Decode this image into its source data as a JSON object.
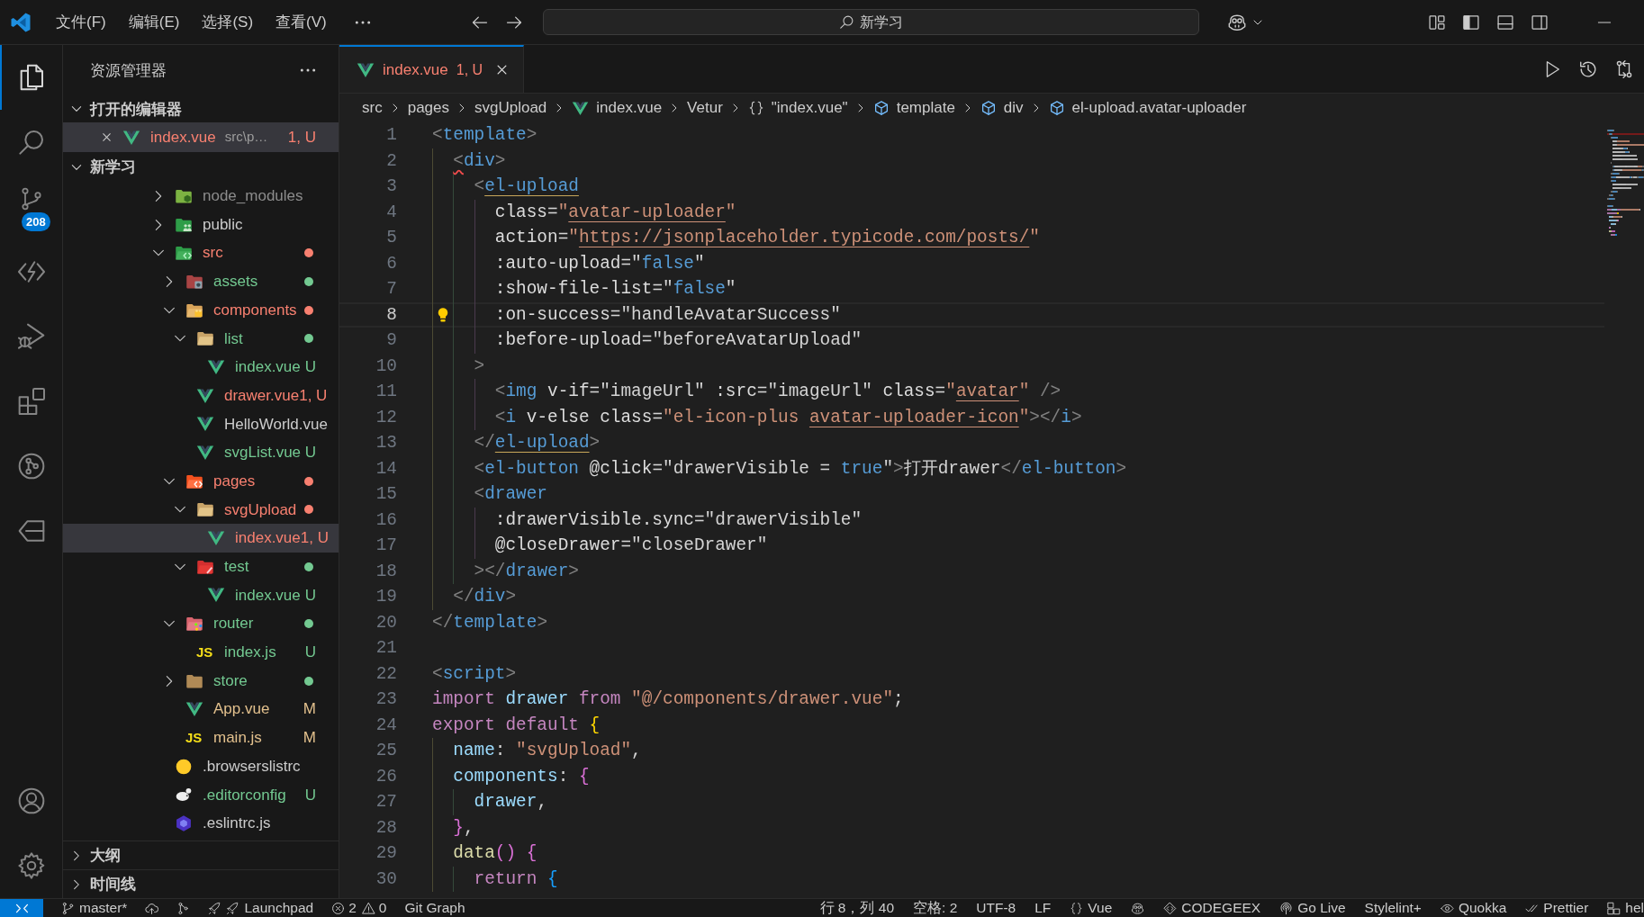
{
  "title_bar": {
    "menus": [
      "文件(F)",
      "编辑(E)",
      "选择(S)",
      "查看(V)"
    ],
    "command_center": {
      "label": "新学习"
    }
  },
  "activity_bar": {
    "items": [
      {
        "kind": "explorer",
        "selected": true
      },
      {
        "kind": "search",
        "selected": false
      },
      {
        "kind": "scm",
        "selected": false,
        "badge": "208"
      },
      {
        "kind": "brackets",
        "selected": false
      },
      {
        "kind": "debug",
        "selected": false
      },
      {
        "kind": "extensions",
        "selected": false
      },
      {
        "kind": "gitgraph",
        "selected": false
      },
      {
        "kind": "tagarrow",
        "selected": false
      }
    ],
    "bottom": [
      {
        "kind": "account"
      },
      {
        "kind": "settings"
      }
    ]
  },
  "sidebar": {
    "title": "资源管理器",
    "open_editors": {
      "title": "打开的编辑器",
      "expanded": true,
      "items": [
        {
          "kind": "vue",
          "name": "index.vue",
          "path": "src\\p…",
          "badge": "1, U",
          "color": "#f88070",
          "selected": true
        }
      ]
    },
    "workspace": {
      "title": "新学习",
      "expanded": true,
      "tree": [
        {
          "kind": "node",
          "name": "node_modules",
          "expanded": false,
          "selected": false,
          "color": "#8c8c8c",
          "has_changes": false
        },
        {
          "kind": "public",
          "name": "public",
          "expanded": false,
          "selected": false,
          "color": "#cccccc",
          "has_changes": false
        },
        {
          "kind": "src",
          "name": "src",
          "expanded": true,
          "selected": false,
          "color": "#f88070",
          "has_changes": true,
          "children": [
            {
              "kind": "assets",
              "name": "assets",
              "expanded": false,
              "selected": false,
              "color": "#73c991",
              "has_changes": true
            },
            {
              "kind": "components",
              "name": "components",
              "expanded": true,
              "selected": false,
              "color": "#f88070",
              "has_changes": true,
              "children": [
                {
                  "kind": "folder",
                  "name": "list",
                  "expanded": true,
                  "selected": false,
                  "color": "#73c991",
                  "has_changes": true,
                  "children": [
                    {
                      "kind": "vue",
                      "name": "index.vue",
                      "selected": false,
                      "color": "#73c991",
                      "badge": "U"
                    }
                  ]
                },
                {
                  "kind": "vue",
                  "name": "drawer.vue",
                  "selected": false,
                  "color": "#f88070",
                  "badge": "1, U"
                },
                {
                  "kind": "vue",
                  "name": "HelloWorld.vue",
                  "selected": false,
                  "color": "#cccccc"
                },
                {
                  "kind": "vue",
                  "name": "svgList.vue",
                  "selected": false,
                  "color": "#73c991",
                  "badge": "U"
                }
              ]
            },
            {
              "kind": "pages",
              "name": "pages",
              "expanded": true,
              "selected": false,
              "color": "#f88070",
              "has_changes": true,
              "children": [
                {
                  "kind": "folder",
                  "name": "svgUpload",
                  "expanded": true,
                  "selected": false,
                  "color": "#f88070",
                  "has_changes": true,
                  "children": [
                    {
                      "kind": "vue",
                      "name": "index.vue",
                      "selected": true,
                      "color": "#f88070",
                      "badge": "1, U"
                    }
                  ]
                },
                {
                  "kind": "test",
                  "name": "test",
                  "expanded": true,
                  "selected": false,
                  "color": "#73c991",
                  "has_changes": true,
                  "children": [
                    {
                      "kind": "vue",
                      "name": "index.vue",
                      "selected": false,
                      "color": "#73c991",
                      "badge": "U"
                    }
                  ]
                }
              ]
            },
            {
              "kind": "router",
              "name": "router",
              "expanded": true,
              "selected": false,
              "color": "#73c991",
              "has_changes": true,
              "children": [
                {
                  "kind": "js",
                  "icon_text": "JS",
                  "name": "index.js",
                  "selected": false,
                  "color": "#73c991",
                  "badge": "U"
                }
              ]
            },
            {
              "kind": "store",
              "name": "store",
              "expanded": false,
              "selected": false,
              "color": "#73c991",
              "has_changes": true
            },
            {
              "kind": "vue",
              "name": "App.vue",
              "selected": false,
              "color": "#e2c08d",
              "badge": "M"
            },
            {
              "kind": "js",
              "icon_text": "JS",
              "name": "main.js",
              "selected": false,
              "color": "#e2c08d",
              "badge": "M"
            }
          ]
        },
        {
          "kind": "browserslist",
          "name": ".browserslistrc",
          "selected": false,
          "color": "#cccccc"
        },
        {
          "kind": "editorconfig",
          "name": ".editorconfig",
          "selected": false,
          "color": "#73c991",
          "badge": "U"
        },
        {
          "kind": "eslint",
          "name": ".eslintrc.js",
          "selected": false,
          "color": "#cccccc"
        }
      ]
    },
    "outline": {
      "title": "大纲",
      "expanded": false
    },
    "timeline": {
      "title": "时间线",
      "expanded": false
    }
  },
  "editor": {
    "tabs": [
      {
        "kind": "vue",
        "label": "index.vue",
        "badge": "1, U",
        "color": "#f88070",
        "selected": true
      }
    ],
    "breadcrumb": [
      {
        "kind": "plain",
        "label": "src"
      },
      {
        "kind": "plain",
        "label": "pages"
      },
      {
        "kind": "plain",
        "label": "svgUpload"
      },
      {
        "kind": "vue",
        "label": "index.vue"
      },
      {
        "kind": "plain",
        "label": "Vetur"
      },
      {
        "kind": "braces",
        "label": "\"index.vue\""
      },
      {
        "kind": "element",
        "label": "template"
      },
      {
        "kind": "element",
        "label": "div"
      },
      {
        "kind": "element",
        "label": "el-upload.avatar-uploader"
      }
    ],
    "lines": [
      {
        "number": "1",
        "current": false,
        "lightbulb": false,
        "tokens": [
          {
            "kind": "punct",
            "text": "<"
          },
          {
            "kind": "tag",
            "text": "template"
          },
          {
            "kind": "punct",
            "text": ">"
          }
        ]
      },
      {
        "number": "2",
        "current": false,
        "lightbulb": false,
        "tokens": [
          {
            "kind": "errpunct",
            "text": "  <"
          },
          {
            "kind": "tag",
            "text": "div"
          },
          {
            "kind": "punct",
            "text": ">"
          }
        ]
      },
      {
        "number": "3",
        "current": false,
        "lightbulb": false,
        "tokens": [
          {
            "kind": "punct",
            "text": "    <"
          },
          {
            "kind": "tagref",
            "text": "el-upload"
          }
        ]
      },
      {
        "number": "4",
        "current": false,
        "lightbulb": false,
        "tokens": [
          {
            "kind": "attr",
            "text": "      class"
          },
          {
            "kind": "text",
            "text": "="
          },
          {
            "kind": "str",
            "text": "\""
          },
          {
            "kind": "link",
            "text": "avatar-uploader"
          },
          {
            "kind": "str",
            "text": "\""
          }
        ]
      },
      {
        "number": "5",
        "current": false,
        "lightbulb": false,
        "tokens": [
          {
            "kind": "attr",
            "text": "      action"
          },
          {
            "kind": "text",
            "text": "="
          },
          {
            "kind": "str",
            "text": "\""
          },
          {
            "kind": "link",
            "text": "https://jsonplaceholder.typicode.com/posts/"
          },
          {
            "kind": "str",
            "text": "\""
          }
        ]
      },
      {
        "number": "6",
        "current": false,
        "lightbulb": false,
        "tokens": [
          {
            "kind": "attr",
            "text": "      :auto-upload"
          },
          {
            "kind": "text",
            "text": "=\""
          },
          {
            "kind": "kw",
            "text": "false"
          },
          {
            "kind": "text",
            "text": "\""
          }
        ]
      },
      {
        "number": "7",
        "current": false,
        "lightbulb": false,
        "tokens": [
          {
            "kind": "attr",
            "text": "      :show-file-list"
          },
          {
            "kind": "text",
            "text": "=\""
          },
          {
            "kind": "kw",
            "text": "false"
          },
          {
            "kind": "text",
            "text": "\""
          }
        ]
      },
      {
        "number": "8",
        "current": true,
        "lightbulb": true,
        "tokens": [
          {
            "kind": "attr",
            "text": "      :on-success"
          },
          {
            "kind": "text",
            "text": "=\"handleAvatarSuccess\""
          }
        ]
      },
      {
        "number": "9",
        "current": false,
        "lightbulb": false,
        "tokens": [
          {
            "kind": "attr",
            "text": "      :before-upload"
          },
          {
            "kind": "text",
            "text": "=\"beforeAvatarUpload\""
          }
        ]
      },
      {
        "number": "10",
        "current": false,
        "lightbulb": false,
        "tokens": [
          {
            "kind": "punct",
            "text": "    >"
          }
        ]
      },
      {
        "number": "11",
        "current": false,
        "lightbulb": false,
        "tokens": [
          {
            "kind": "punct",
            "text": "      <"
          },
          {
            "kind": "tag",
            "text": "img"
          },
          {
            "kind": "attr",
            "text": " v-if"
          },
          {
            "kind": "text",
            "text": "=\"imageUrl\" "
          },
          {
            "kind": "attr",
            "text": ":src"
          },
          {
            "kind": "text",
            "text": "=\"imageUrl\" "
          },
          {
            "kind": "attr",
            "text": "class"
          },
          {
            "kind": "text",
            "text": "="
          },
          {
            "kind": "str",
            "text": "\""
          },
          {
            "kind": "link",
            "text": "avatar"
          },
          {
            "kind": "str",
            "text": "\""
          },
          {
            "kind": "punct",
            "text": " />"
          }
        ]
      },
      {
        "number": "12",
        "current": false,
        "lightbulb": false,
        "tokens": [
          {
            "kind": "punct",
            "text": "      <"
          },
          {
            "kind": "tag",
            "text": "i"
          },
          {
            "kind": "attr",
            "text": " v-else"
          },
          {
            "kind": "attr",
            "text": " class"
          },
          {
            "kind": "text",
            "text": "="
          },
          {
            "kind": "str",
            "text": "\"el-icon-plus "
          },
          {
            "kind": "link",
            "text": "avatar-uploader-icon"
          },
          {
            "kind": "str",
            "text": "\""
          },
          {
            "kind": "punct",
            "text": "></"
          },
          {
            "kind": "tag",
            "text": "i"
          },
          {
            "kind": "punct",
            "text": ">"
          }
        ]
      },
      {
        "number": "13",
        "current": false,
        "lightbulb": false,
        "tokens": [
          {
            "kind": "punct",
            "text": "    </"
          },
          {
            "kind": "tagref",
            "text": "el-upload"
          },
          {
            "kind": "punct",
            "text": ">"
          }
        ]
      },
      {
        "number": "14",
        "current": false,
        "lightbulb": false,
        "tokens": [
          {
            "kind": "punct",
            "text": "    <"
          },
          {
            "kind": "tag",
            "text": "el-button"
          },
          {
            "kind": "attr",
            "text": " @click"
          },
          {
            "kind": "text",
            "text": "=\"drawerVisible = "
          },
          {
            "kind": "kw",
            "text": "true"
          },
          {
            "kind": "text",
            "text": "\""
          },
          {
            "kind": "punct",
            "text": ">"
          },
          {
            "kind": "text",
            "text": "打开drawer"
          },
          {
            "kind": "punct",
            "text": "</"
          },
          {
            "kind": "tag",
            "text": "el-button"
          },
          {
            "kind": "punct",
            "text": ">"
          }
        ]
      },
      {
        "number": "15",
        "current": false,
        "lightbulb": false,
        "tokens": [
          {
            "kind": "punct",
            "text": "    <"
          },
          {
            "kind": "tag",
            "text": "drawer"
          }
        ]
      },
      {
        "number": "16",
        "current": false,
        "lightbulb": false,
        "tokens": [
          {
            "kind": "attr",
            "text": "      :drawerVisible.sync"
          },
          {
            "kind": "text",
            "text": "=\"drawerVisible\""
          }
        ]
      },
      {
        "number": "17",
        "current": false,
        "lightbulb": false,
        "tokens": [
          {
            "kind": "attr",
            "text": "      @closeDrawer"
          },
          {
            "kind": "text",
            "text": "=\"closeDrawer\""
          }
        ]
      },
      {
        "number": "18",
        "current": false,
        "lightbulb": false,
        "tokens": [
          {
            "kind": "punct",
            "text": "    ></"
          },
          {
            "kind": "tag",
            "text": "drawer"
          },
          {
            "kind": "punct",
            "text": ">"
          }
        ]
      },
      {
        "number": "19",
        "current": false,
        "lightbulb": false,
        "tokens": [
          {
            "kind": "punct",
            "text": "  </"
          },
          {
            "kind": "tag",
            "text": "div"
          },
          {
            "kind": "punct",
            "text": ">"
          }
        ]
      },
      {
        "number": "20",
        "current": false,
        "lightbulb": false,
        "tokens": [
          {
            "kind": "punct",
            "text": "</"
          },
          {
            "kind": "tag",
            "text": "template"
          },
          {
            "kind": "punct",
            "text": ">"
          }
        ]
      },
      {
        "number": "21",
        "current": false,
        "lightbulb": false
      },
      {
        "number": "22",
        "current": false,
        "lightbulb": false,
        "tokens": [
          {
            "kind": "punct",
            "text": "<"
          },
          {
            "kind": "tag",
            "text": "script"
          },
          {
            "kind": "punct",
            "text": ">"
          }
        ]
      },
      {
        "number": "23",
        "current": false,
        "lightbulb": false,
        "tokens": [
          {
            "kind": "ctrl",
            "text": "import"
          },
          {
            "kind": "var",
            "text": " drawer"
          },
          {
            "kind": "ctrl",
            "text": " from"
          },
          {
            "kind": "str",
            "text": " \"@/components/drawer.vue\""
          },
          {
            "kind": "text",
            "text": ";"
          }
        ]
      },
      {
        "number": "24",
        "current": false,
        "lightbulb": false,
        "tokens": [
          {
            "kind": "ctrl",
            "text": "export"
          },
          {
            "kind": "ctrl",
            "text": " default"
          },
          {
            "kind": "brace1",
            "text": " {"
          }
        ]
      },
      {
        "number": "25",
        "current": false,
        "lightbulb": false,
        "tokens": [
          {
            "kind": "var",
            "text": "  name"
          },
          {
            "kind": "text",
            "text": ": "
          },
          {
            "kind": "str",
            "text": "\"svgUpload\""
          },
          {
            "kind": "text",
            "text": ","
          }
        ]
      },
      {
        "number": "26",
        "current": false,
        "lightbulb": false,
        "tokens": [
          {
            "kind": "var",
            "text": "  components"
          },
          {
            "kind": "text",
            "text": ": "
          },
          {
            "kind": "brace2",
            "text": "{"
          }
        ]
      },
      {
        "number": "27",
        "current": false,
        "lightbulb": false,
        "tokens": [
          {
            "kind": "var",
            "text": "    drawer"
          },
          {
            "kind": "text",
            "text": ","
          }
        ]
      },
      {
        "number": "28",
        "current": false,
        "lightbulb": false,
        "tokens": [
          {
            "kind": "brace2",
            "text": "  }"
          },
          {
            "kind": "text",
            "text": ","
          }
        ]
      },
      {
        "number": "29",
        "current": false,
        "lightbulb": false,
        "tokens": [
          {
            "kind": "fn",
            "text": "  data"
          },
          {
            "kind": "brace2",
            "text": "()"
          },
          {
            "kind": "brace2",
            "text": " {"
          }
        ]
      },
      {
        "number": "30",
        "current": false,
        "lightbulb": false,
        "tokens": [
          {
            "kind": "ctrl",
            "text": "    return"
          },
          {
            "kind": "brace3",
            "text": " {"
          }
        ]
      }
    ]
  },
  "status_bar": {
    "left": [
      {
        "kind": "remote"
      },
      {
        "kind": "branch",
        "label": "master*"
      },
      {
        "kind": "sync"
      },
      {
        "kind": "graph"
      },
      {
        "kind": "launchpad",
        "label": "Launchpad"
      },
      {
        "kind": "problems",
        "errors": "2",
        "warnings": "0"
      },
      {
        "kind": "plain",
        "label": "Git Graph"
      }
    ],
    "right": [
      {
        "kind": "plain",
        "label": "行 8，列 40"
      },
      {
        "kind": "plain",
        "label": "空格: 2"
      },
      {
        "kind": "plain",
        "label": "UTF-8"
      },
      {
        "kind": "plain",
        "label": "LF"
      },
      {
        "kind": "braces",
        "label": "Vue"
      },
      {
        "kind": "robot"
      },
      {
        "kind": "codegeex",
        "label": "CODEGEEX"
      },
      {
        "kind": "golive",
        "label": "Go Live"
      },
      {
        "kind": "plain",
        "label": "Stylelint+"
      },
      {
        "kind": "quokka",
        "label": "Quokka"
      },
      {
        "kind": "prettier",
        "label": "Prettier"
      },
      {
        "kind": "layout",
        "label": "hel"
      }
    ]
  }
}
